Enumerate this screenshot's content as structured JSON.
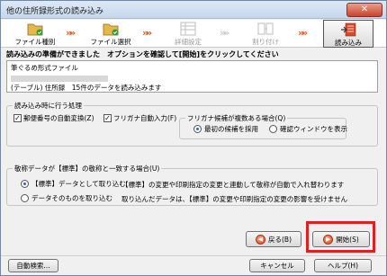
{
  "window": {
    "title": "他の住所録形式の読み込み",
    "close_glyph": "✕"
  },
  "steps": [
    {
      "label": "ファイル種別",
      "icon": "folder-icon",
      "state": "done"
    },
    {
      "label": "ファイル選択",
      "icon": "folder-icon",
      "state": "done"
    },
    {
      "label": "詳細設定",
      "icon": "settings-grid-icon",
      "state": "disabled"
    },
    {
      "label": "割り付け",
      "icon": "assign-icon",
      "state": "disabled"
    },
    {
      "label": "読み込み",
      "icon": "import-icon",
      "state": "active"
    }
  ],
  "instruction": "読み込みの準備ができました　オプションを確認して[開始]をクリックしてください",
  "info": {
    "line1": "筆ぐるめ形式ファイル",
    "line3": "(テーブル)  住所録　15件のデータを読み込みます"
  },
  "options_group": {
    "title": "読み込み時に行う処理",
    "postal_label": "郵便番号の自動変換(Z)",
    "postal_checked": true,
    "furigana_label": "フリガナ自動入力(F)",
    "furigana_checked": true,
    "furigana_group": {
      "title": "フリガナ候補が複数ある場合(Q)",
      "first_label": "最初の候補を採用",
      "confirm_label": "確認ウィンドウを表示",
      "selected": "first"
    }
  },
  "title_group": {
    "title": "敬称データが【標準】の敬称と一致する場合(U)",
    "standard_label": "【標準】データとして取り込む",
    "standard_desc": "【標準】の変更や印刷指定の変更と連動して敬称が自動で入れ替わります",
    "data_label": "データそのものを取り込む",
    "data_desc": "取り込んだデータは、【標準】の変更や印刷指定の変更の影響を受けません",
    "selected": "standard"
  },
  "buttons": {
    "back": "戻る(B)",
    "start": "開始(S)",
    "auto_search": "自動検索...",
    "cancel": "キャンセル",
    "help": "ヘルプ(H)"
  },
  "colors": {
    "accent_arrow": "#d85a2c",
    "highlight": "#e0201e"
  }
}
